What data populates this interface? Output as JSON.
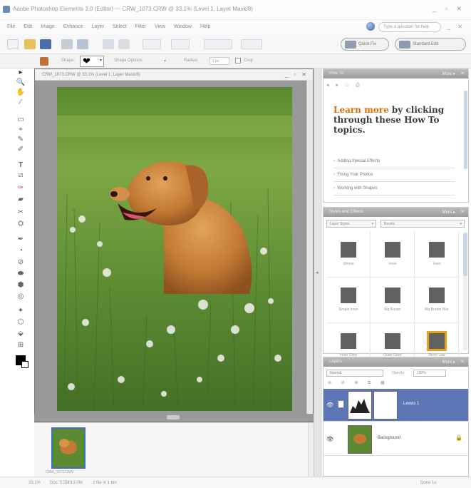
{
  "app": {
    "title": "Adobe Photoshop Elements 3.0 (Editor) — CRW_1073.CRW @ 33.1% (Level 1, Layer Mask/8)",
    "window_controls": "_ ▫ ✕"
  },
  "menu": {
    "items": [
      "File",
      "Edit",
      "Image",
      "Enhance",
      "Layer",
      "Select",
      "Filter",
      "View",
      "Window",
      "Help"
    ],
    "help_placeholder": "Type a question for help",
    "doc_controls": "_ ✕"
  },
  "toolbar": {
    "quick_fix": "Quick Fix",
    "standard_edit": "Standard Edit"
  },
  "options_bar": {
    "shape_label": "Shape:",
    "shape_glyph": "❤",
    "shape_dropdown": "▾",
    "shape_options_label": "Shape Options",
    "shape_options_dropdown": "▾",
    "radius_label": "Radius:",
    "radius_value": "1 px",
    "crop_label": "Crop"
  },
  "tools": [
    "▸",
    "🔍",
    "✋",
    "⁄",
    "▭",
    "⌖",
    "✎",
    "✐",
    "T",
    "⧄",
    "✑",
    "▰",
    "✂",
    "⛭",
    "✒",
    "◔",
    "⊘",
    "⬬",
    "⬢",
    "◎",
    "✦",
    "⬡",
    "⬙",
    "⊞"
  ],
  "document": {
    "title": "CRW_1073.CRW @ 33.1% (Level 1, Layer Mask/8)",
    "controls": "_ ▫ ✕"
  },
  "photo_bin": {
    "caption": "CRW_1073.CRW"
  },
  "status": {
    "zoom": "33.1%",
    "doc_info": "Doc: 5.5M/13.0M",
    "size_info": "2 file in 1 bin",
    "right": "Done 1s"
  },
  "how_to": {
    "title": "How To",
    "more": "More ▸",
    "close": "✕",
    "nav": "◂ ▸ ⌂ ⎙",
    "learn_highlight": "Learn more",
    "learn_rest": " by clicking through these How To topics.",
    "items": [
      "Adding Special Effects",
      "Fixing Your Photos",
      "Working with Shapes"
    ]
  },
  "styles_effects": {
    "title": "Styles and Effects",
    "more": "More ▸",
    "close": "✕",
    "category": "Layer Styles",
    "library": "Bevels",
    "dropdown": "▾",
    "items": [
      "Simple",
      "Inner",
      "Inset",
      "Simple Inner",
      "Big Border",
      "Big Border Blur",
      "Inner Glow",
      "Outer Glow",
      "Bevel Low"
    ]
  },
  "layers": {
    "title": "Layers",
    "more": "More ▸",
    "close": "✕",
    "blend_mode": "Normal",
    "opacity_label": "Opacity:",
    "opacity_value": "100%",
    "tools": "⊕ ⊘ ⊗ ⧉ ▦",
    "eye": "👁",
    "lock": "🔒",
    "rows": [
      {
        "name": "Levels 1",
        "selected": true
      },
      {
        "name": "Background",
        "selected": false
      }
    ]
  },
  "colors": {
    "selected_layer": "#5c76b6",
    "accent_orange": "#e06c00",
    "highlight_swatch": "#e7a31e"
  }
}
